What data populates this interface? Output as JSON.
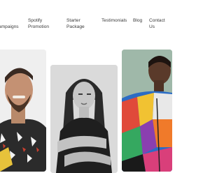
{
  "nav": {
    "items": [
      {
        "line1": "l",
        "line2": "ampaigns"
      },
      {
        "line1": "Spotify",
        "line2": "Promotion"
      },
      {
        "line1": "Starter",
        "line2": "Package"
      },
      {
        "line1": "Testimonials",
        "line2": ""
      },
      {
        "line1": "Blog",
        "line2": ""
      },
      {
        "line1": "Contact",
        "line2": "Us"
      }
    ]
  },
  "gallery": {
    "cards": [
      {
        "subject": "tattooed artist portrait (color)"
      },
      {
        "subject": "woman portrait (black and white)"
      },
      {
        "subject": "artist in colorful jacket (color)"
      }
    ]
  },
  "colors": {
    "nav_text": "#3a3a3a",
    "background": "#ffffff"
  }
}
